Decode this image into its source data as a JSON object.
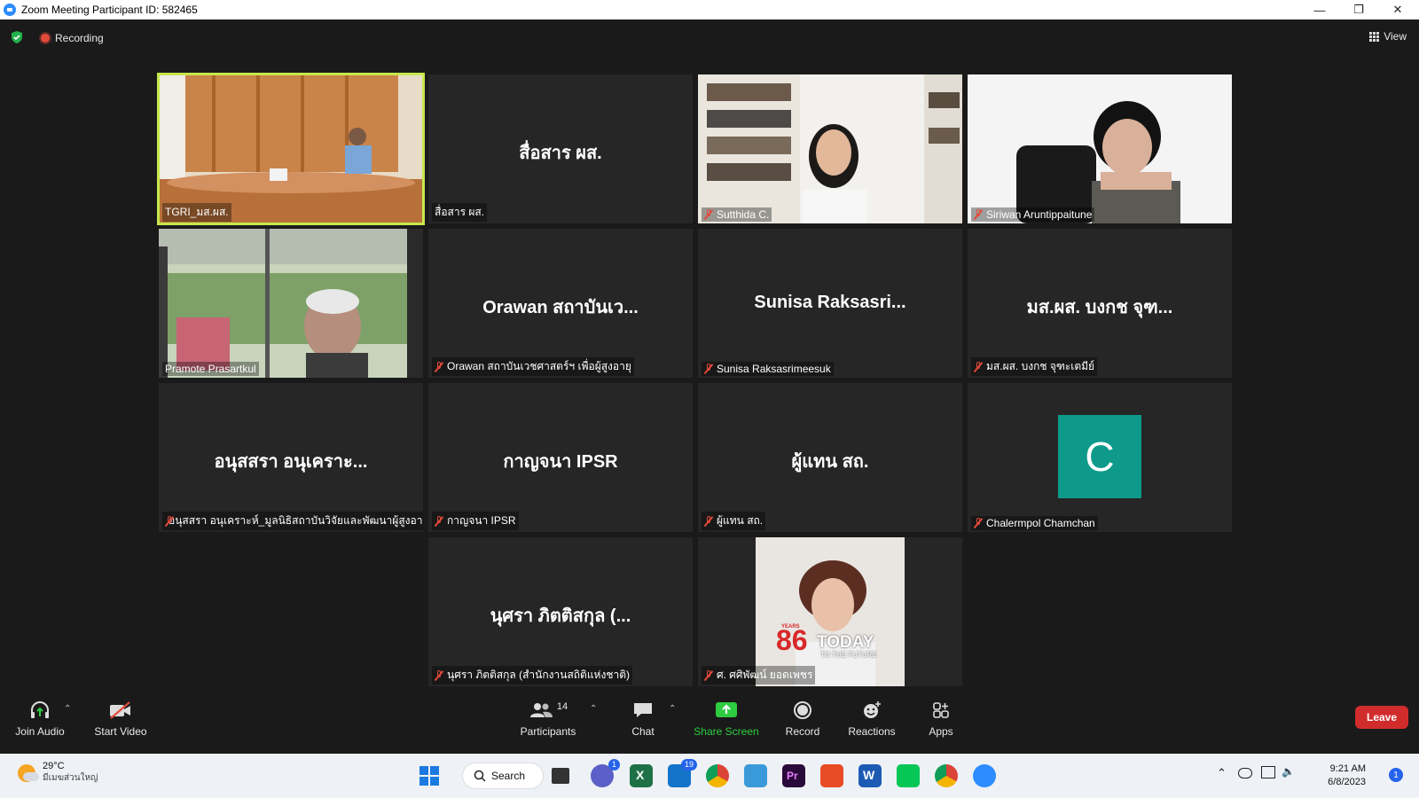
{
  "window": {
    "title": "Zoom Meeting Participant ID: 582465"
  },
  "topbar": {
    "recording_label": "Recording",
    "view_label": "View"
  },
  "tiles": [
    {
      "big": "",
      "name": "TGRI_มส.ผส.",
      "video": true,
      "muted": false,
      "active": true
    },
    {
      "big": "สื่อสาร ผส.",
      "name": "สื่อสาร ผส.",
      "video": false,
      "muted": false
    },
    {
      "big": "",
      "name": "Sutthida C.",
      "video": true,
      "muted": true
    },
    {
      "big": "",
      "name": "Siriwan Aruntippaitune",
      "video": true,
      "muted": true
    },
    {
      "big": "",
      "name": "Pramote Prasartkul",
      "video": true,
      "muted": false
    },
    {
      "big": "Orawan สถาบันเว...",
      "name": "Orawan สถาบันเวชศาสตร์ฯ เพื่อผู้สูงอายุ",
      "video": false,
      "muted": true
    },
    {
      "big": "Sunisa  Raksasri...",
      "name": "Sunisa Raksasrimeesuk",
      "video": false,
      "muted": true
    },
    {
      "big": "มส.ผส.  บงกช จุฑ...",
      "name": "มส.ผส.  บงกช จุฑะเตมีย์",
      "video": false,
      "muted": true
    },
    {
      "big": "อนุสสรา อนุเคราะ...",
      "name": "อนุสสรา อนุเคราะห์_มูลนิธิสถาบันวิจัยและพัฒนาผู้สูงอา...",
      "video": false,
      "muted": true
    },
    {
      "big": "กาญจนา IPSR",
      "name": "กาญจนา IPSR",
      "video": false,
      "muted": true
    },
    {
      "big": "ผู้แทน สถ.",
      "name": "ผู้แทน สถ.",
      "video": false,
      "muted": true
    },
    {
      "big": "",
      "avatar": "C",
      "name": "Chalermpol Chamchan",
      "video": false,
      "muted": true
    },
    {
      "big": "นุศรา  ภิตติสกุล (...",
      "name": "นุศรา  ภิตติสกุล (สำนักงานสถิติแห่งชาติ)",
      "video": false,
      "muted": true
    },
    {
      "big": "",
      "name": "ศ. ศศิพัฒน์ ยอดเพชร",
      "video": true,
      "muted": true,
      "overlay_text": "TODAY",
      "overlay_sub": "TO THE FUTURE",
      "overlay_num": "86",
      "overlay_years": "YEARS"
    }
  ],
  "toolbar": {
    "join_audio": "Join Audio",
    "start_video": "Start Video",
    "participants": "Participants",
    "participants_count": "14",
    "chat": "Chat",
    "share_screen": "Share Screen",
    "record": "Record",
    "reactions": "Reactions",
    "apps": "Apps",
    "leave": "Leave"
  },
  "taskbar": {
    "temp": "29°C",
    "weather_desc": "มีเมฆส่วนใหญ่",
    "search": "Search",
    "teams_badge": "1",
    "mail_badge": "19",
    "time": "9:21 AM",
    "date": "6/8/2023",
    "notif_badge": "1"
  },
  "colors": {
    "active_border": "#c6e84b",
    "leave": "#d12c2c",
    "share": "#2ecc40",
    "avatar_c": "#0e9a8a"
  }
}
